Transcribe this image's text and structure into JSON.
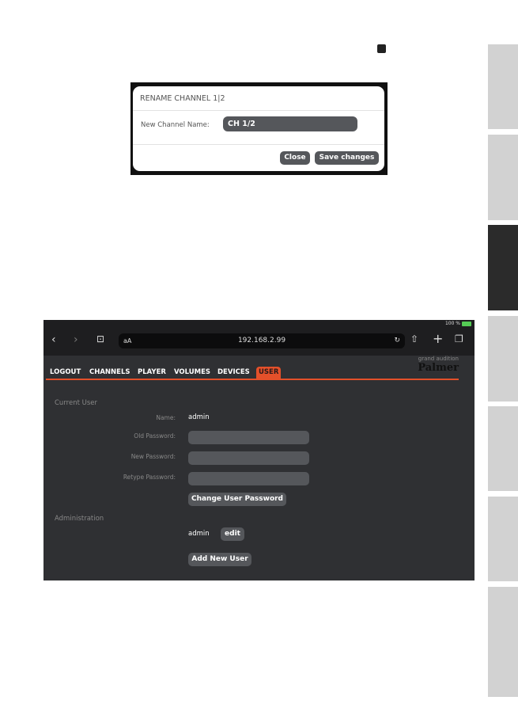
{
  "dialog": {
    "title": "RENAME CHANNEL 1|2",
    "label": "New Channel Name:",
    "value": "CH 1/2",
    "close": "Close",
    "save": "Save changes"
  },
  "browser": {
    "url": "192.168.2.99",
    "text_size": "aA",
    "battery": "100 %"
  },
  "nav": {
    "items": [
      "LOGOUT",
      "CHANNELS",
      "PLAYER",
      "VOLUMES",
      "DEVICES",
      "USER"
    ],
    "active": "USER"
  },
  "brand": {
    "tagline": "grand audition",
    "name": "Palmer"
  },
  "current_user": {
    "heading": "Current User",
    "name_label": "Name:",
    "name_value": "admin",
    "old_label": "Old Password:",
    "new_label": "New Password:",
    "retype_label": "Retype Password:",
    "change_button": "Change User Password"
  },
  "administration": {
    "heading": "Administration",
    "user": "admin",
    "edit": "edit",
    "add": "Add New User"
  },
  "colors": {
    "accent": "#e4502a",
    "panel": "#2f3033"
  }
}
